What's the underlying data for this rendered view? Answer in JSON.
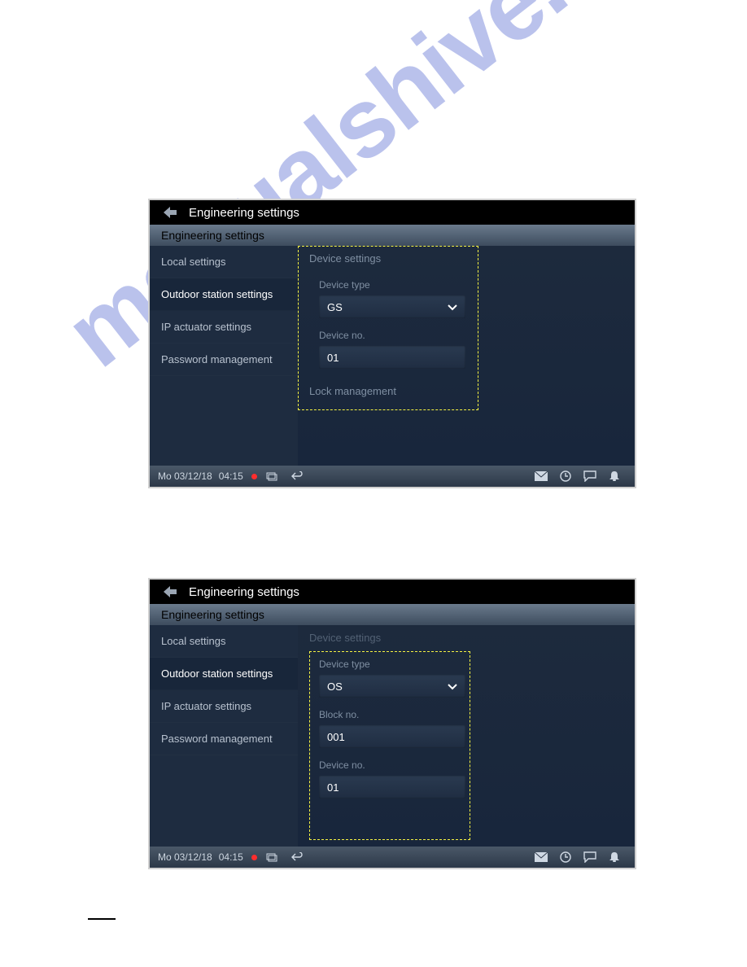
{
  "watermark": "manualshive.com",
  "screens": {
    "a": {
      "title": "Engineering settings",
      "subheader": "Engineering settings",
      "sidebar": [
        {
          "label": "Local settings",
          "active": false
        },
        {
          "label": "Outdoor station settings",
          "active": true
        },
        {
          "label": "IP actuator settings",
          "active": false
        },
        {
          "label": "Password management",
          "active": false
        }
      ],
      "section_device_settings": "Device settings",
      "device_type_label": "Device type",
      "device_type_value": "GS",
      "device_no_label": "Device no.",
      "device_no_value": "01",
      "section_lock_management": "Lock management",
      "footer_date": "Mo 03/12/18",
      "footer_time": "04:15"
    },
    "b": {
      "title": "Engineering settings",
      "subheader": "Engineering settings",
      "sidebar": [
        {
          "label": "Local settings",
          "active": false
        },
        {
          "label": "Outdoor station settings",
          "active": true
        },
        {
          "label": "IP actuator settings",
          "active": false
        },
        {
          "label": "Password management",
          "active": false
        }
      ],
      "section_device_settings": "Device settings",
      "device_type_label": "Device type",
      "device_type_value": "OS",
      "block_no_label": "Block no.",
      "block_no_value": "001",
      "device_no_label": "Device no.",
      "device_no_value": "01",
      "footer_date": "Mo 03/12/18",
      "footer_time": "04:15"
    }
  }
}
